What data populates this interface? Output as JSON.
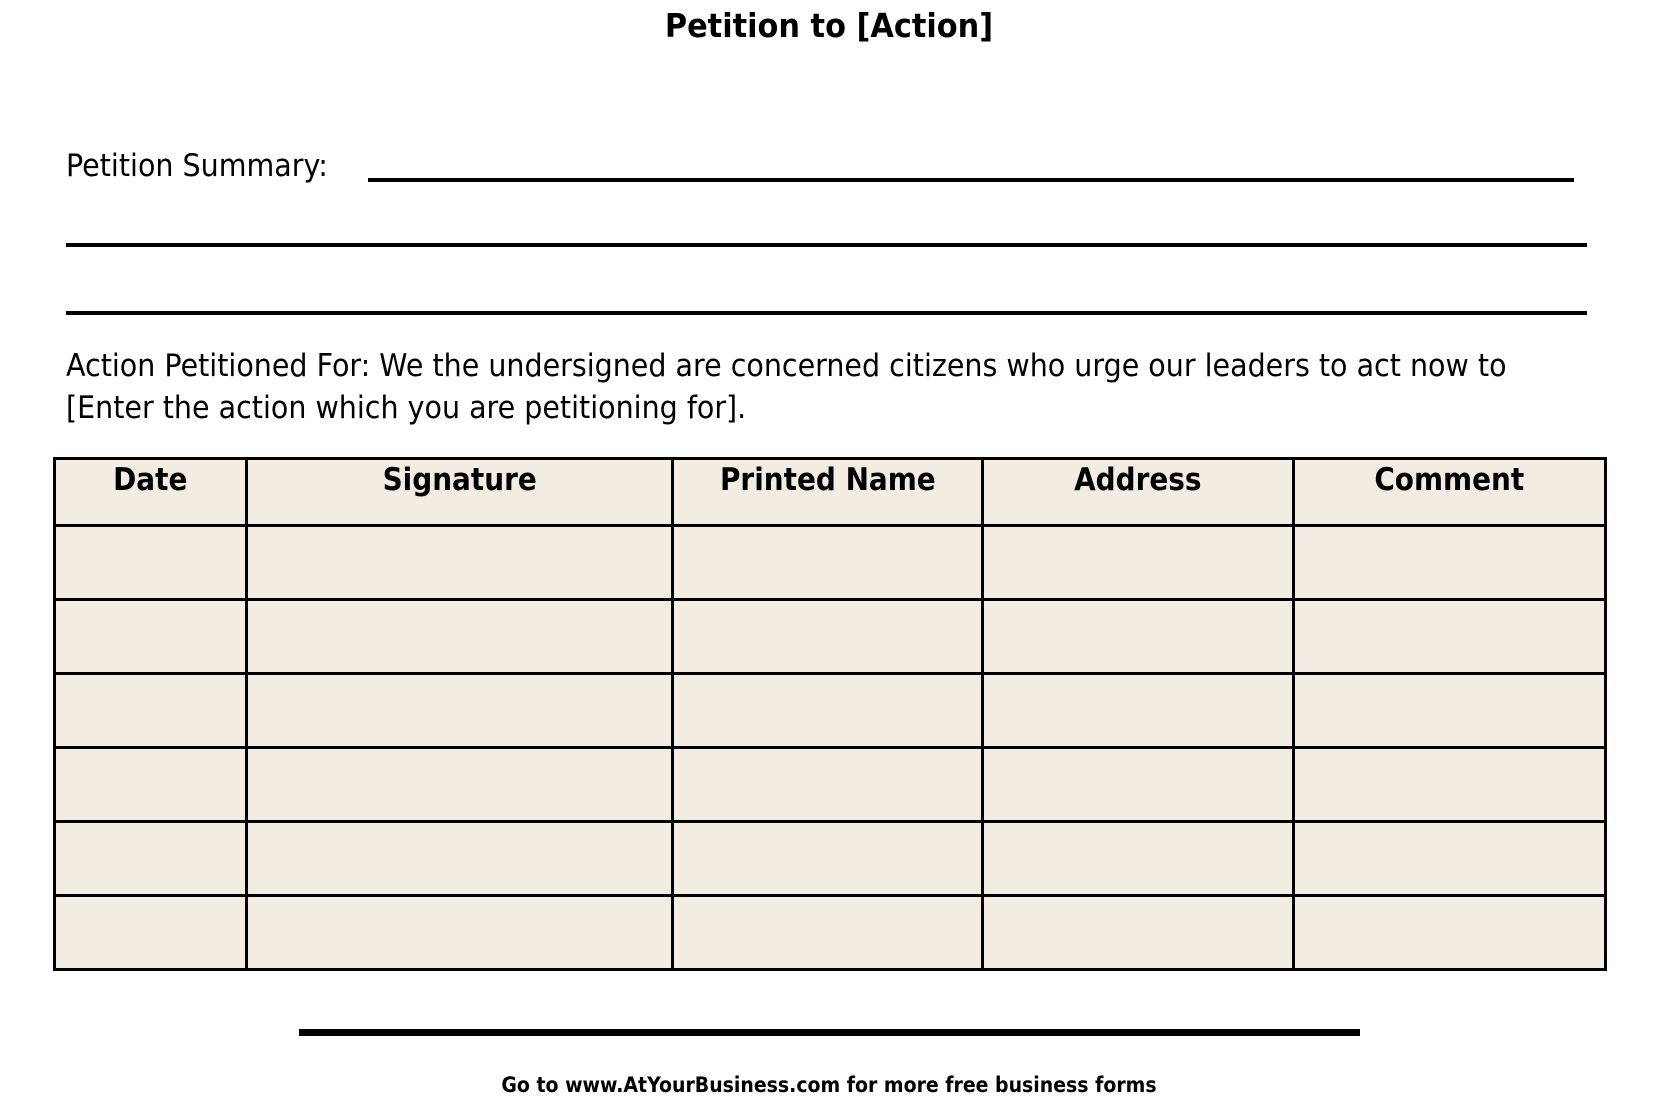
{
  "document": {
    "title": "Petition to [Action]",
    "summary_label": "Petition Summary:",
    "action_text": "Action Petitioned For: We the undersigned are concerned citizens who urge our leaders to act now to [Enter the action which you are petitioning for].",
    "table": {
      "columns": [
        "Date",
        "Signature",
        "Printed Name",
        "Address",
        "Comment"
      ],
      "rows": [
        [
          "",
          "",
          "",
          "",
          ""
        ],
        [
          "",
          "",
          "",
          "",
          ""
        ],
        [
          "",
          "",
          "",
          "",
          ""
        ],
        [
          "",
          "",
          "",
          "",
          ""
        ],
        [
          "",
          "",
          "",
          "",
          ""
        ],
        [
          "",
          "",
          "",
          "",
          ""
        ]
      ],
      "cell_color": "#f2ece2",
      "border_color": "#000000"
    },
    "footer_note": "Go to www.AtYourBusiness.com for more free business forms"
  }
}
